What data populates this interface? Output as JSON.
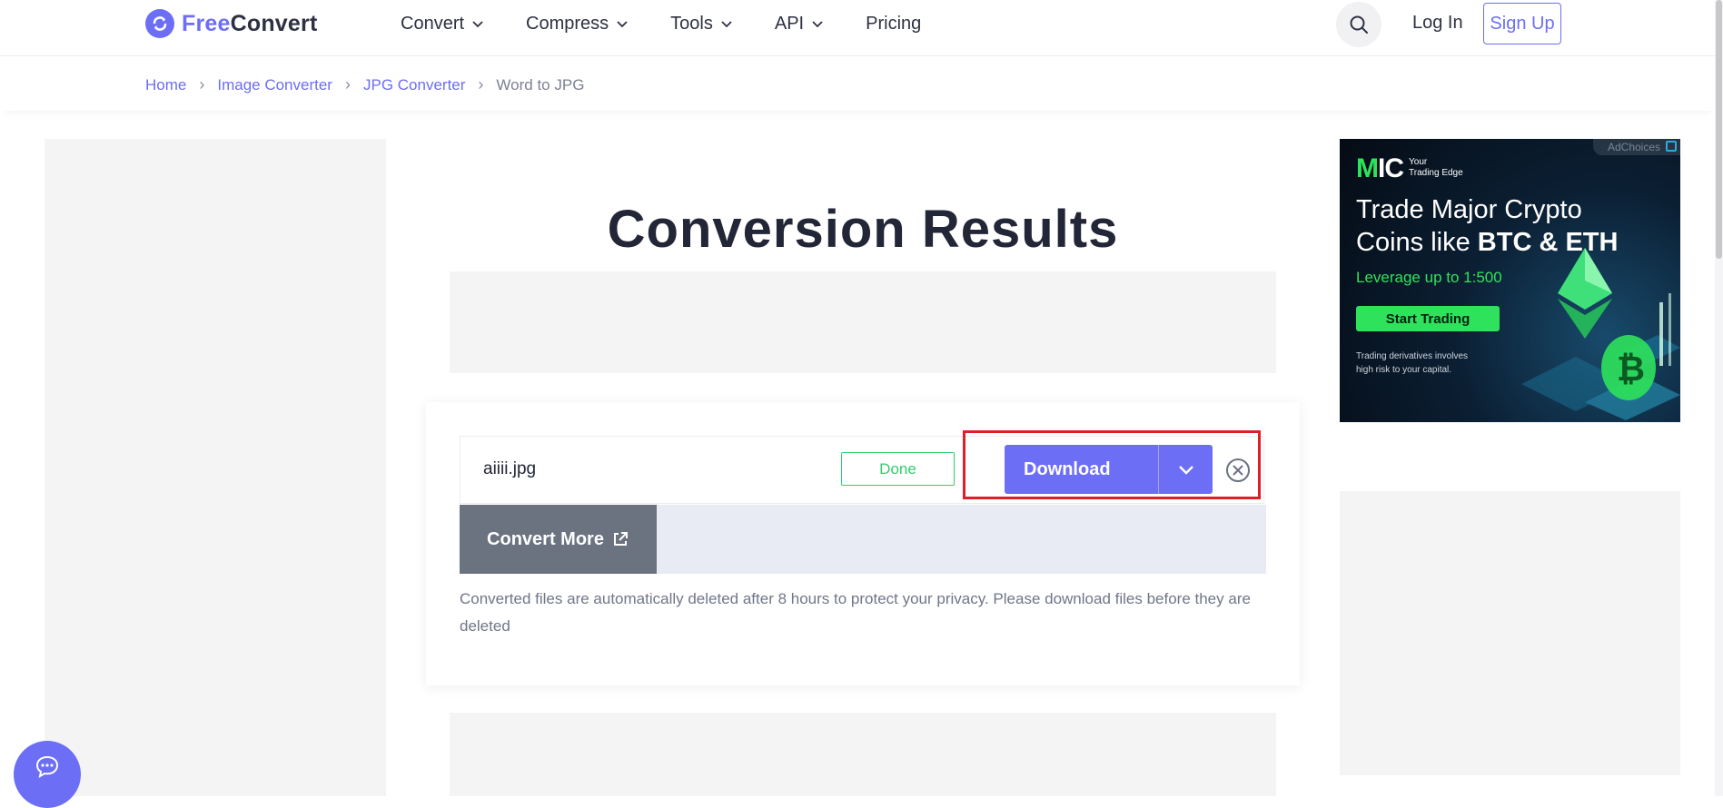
{
  "header": {
    "logo": {
      "part1": "Free",
      "part2": "Convert"
    },
    "nav": [
      {
        "label": "Convert",
        "has_menu": true
      },
      {
        "label": "Compress",
        "has_menu": true
      },
      {
        "label": "Tools",
        "has_menu": true
      },
      {
        "label": "API",
        "has_menu": true
      },
      {
        "label": "Pricing",
        "has_menu": false
      }
    ],
    "login_label": "Log In",
    "signup_label": "Sign Up",
    "search_icon": "search-icon"
  },
  "breadcrumb": {
    "items": [
      "Home",
      "Image Converter",
      "JPG Converter",
      "Word to JPG"
    ]
  },
  "main": {
    "title": "Conversion Results",
    "file": {
      "name": "aiiii.jpg",
      "status": "Done",
      "download_label": "Download"
    },
    "convert_more_label": "Convert More",
    "privacy_note": "Converted files are automatically deleted after 8 hours to protect your privacy. Please download files before they are deleted"
  },
  "ad": {
    "adchoices": "AdChoices",
    "brand_tag_line1": "Your",
    "brand_tag_line2": "Trading Edge",
    "headline_line1": "Trade Major Crypto",
    "headline_line2_prefix": "Coins like ",
    "headline_line2_bold": "BTC & ETH",
    "leverage": "Leverage up to 1:500",
    "cta": "Start Trading",
    "disclaimer_line1": "Trading derivatives involves",
    "disclaimer_line2": "high risk to your capital."
  },
  "colors": {
    "brand": "#6c6ef6",
    "done_green": "#2fcf6d",
    "highlight_red": "#e01e28",
    "convert_more_gray": "#6b7280"
  }
}
